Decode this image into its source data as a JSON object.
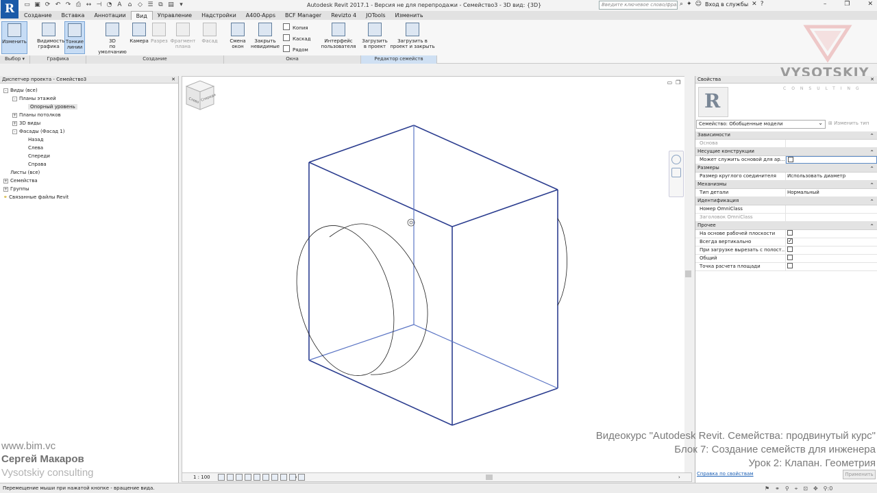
{
  "window": {
    "app_logo": "R",
    "title": "Autodesk Revit 2017.1 - Версия не для перепродажи -    Семейство3 - 3D вид: {3D}",
    "search_placeholder": "Введите ключевое слово/фразу",
    "sign_in": "Вход в службы"
  },
  "tabs": [
    "Создание",
    "Вставка",
    "Аннотации",
    "Вид",
    "Управление",
    "Надстройки",
    "A400-Apps",
    "BCF Manager",
    "Revizto 4",
    "JOTools",
    "Изменить"
  ],
  "active_tab": "Вид",
  "ribbon": {
    "buttons": [
      {
        "label1": "Изменить",
        "label2": "",
        "state": "selected"
      },
      {
        "label1": "Видимость/",
        "label2": "графика",
        "state": "normal"
      },
      {
        "label1": "Тонкие",
        "label2": "линии",
        "state": "selected"
      },
      {
        "label1": "3D",
        "label2": "по умолчанию",
        "state": "normal"
      },
      {
        "label1": "Камера",
        "label2": "",
        "state": "normal"
      },
      {
        "label1": "Разрез",
        "label2": "",
        "state": "disabled"
      },
      {
        "label1": "Фрагмент",
        "label2": "плана",
        "state": "disabled"
      },
      {
        "label1": "Фасад",
        "label2": "",
        "state": "disabled"
      },
      {
        "label1": "Смена",
        "label2": "окон",
        "state": "normal"
      },
      {
        "label1": "Закрыть",
        "label2": "невидимые",
        "state": "normal"
      },
      {
        "label1": "Интерфейс",
        "label2": "пользователя",
        "state": "normal"
      },
      {
        "label1": "Загрузить",
        "label2": "в проект",
        "state": "normal"
      },
      {
        "label1": "Загрузить в",
        "label2": "проект и закрыть",
        "state": "normal"
      }
    ],
    "window_small_buttons": [
      "Копия",
      "Каскад",
      "Рядом"
    ],
    "panels": [
      "Выбор",
      "Графика",
      "Создание",
      "Окна",
      "Редактор семейств"
    ]
  },
  "brand": {
    "name": "VYSOTSKIY",
    "sub": "CONSULTING"
  },
  "project_browser": {
    "title": "Диспетчер проекта - Семейство3",
    "tree": [
      {
        "label": "Виды (все)",
        "level": 0,
        "toggle": "-"
      },
      {
        "label": "Планы этажей",
        "level": 1,
        "toggle": "-"
      },
      {
        "label": "Опорный уровень",
        "level": 2,
        "toggle": "",
        "selected": true
      },
      {
        "label": "Планы потолков",
        "level": 1,
        "toggle": "+"
      },
      {
        "label": "3D виды",
        "level": 1,
        "toggle": "+"
      },
      {
        "label": "Фасады (Фасад 1)",
        "level": 1,
        "toggle": "-"
      },
      {
        "label": "Назад",
        "level": 2,
        "toggle": ""
      },
      {
        "label": "Слева",
        "level": 2,
        "toggle": ""
      },
      {
        "label": "Спереди",
        "level": 2,
        "toggle": ""
      },
      {
        "label": "Справа",
        "level": 2,
        "toggle": ""
      },
      {
        "label": "Листы (все)",
        "level": 0,
        "toggle": ""
      },
      {
        "label": "Семейства",
        "level": 0,
        "toggle": "+"
      },
      {
        "label": "Группы",
        "level": 0,
        "toggle": "+"
      },
      {
        "label": "Связанные файлы Revit",
        "level": 0,
        "toggle": "",
        "icon": "link-icon"
      }
    ]
  },
  "viewcube": {
    "face1": "Слева",
    "face2": "Спереди"
  },
  "view_control": {
    "scale": "1 : 100"
  },
  "properties": {
    "title": "Свойства",
    "type_selector": "Семейство: Обобщенные модели",
    "edit_type": "Изменить тип",
    "rows": [
      {
        "type": "section",
        "label": "Зависимости"
      },
      {
        "type": "row",
        "label": "Основа",
        "value": "",
        "dim": true
      },
      {
        "type": "section",
        "label": "Несущие конструкции"
      },
      {
        "type": "row",
        "label": "Может служить основой для ар...",
        "value": "",
        "check": "off",
        "highlight": true
      },
      {
        "type": "section",
        "label": "Размеры"
      },
      {
        "type": "row",
        "label": "Размер круглого соединителя",
        "value": "Использовать диаметр"
      },
      {
        "type": "section",
        "label": "Механизмы"
      },
      {
        "type": "row",
        "label": "Тип детали",
        "value": "Нормальный"
      },
      {
        "type": "section",
        "label": "Идентификация"
      },
      {
        "type": "row",
        "label": "Номер OmniClass",
        "value": ""
      },
      {
        "type": "row",
        "label": "Заголовок OmniClass",
        "value": "",
        "dim": true
      },
      {
        "type": "section",
        "label": "Прочее"
      },
      {
        "type": "row",
        "label": "На основе рабочей плоскости",
        "value": "",
        "check": "off"
      },
      {
        "type": "row",
        "label": "Всегда вертикально",
        "value": "",
        "check": "on"
      },
      {
        "type": "row",
        "label": "При загрузке вырезать с полост...",
        "value": "",
        "check": "off"
      },
      {
        "type": "row",
        "label": "Общий",
        "value": "",
        "check": "off"
      },
      {
        "type": "row",
        "label": "Точка расчета площади",
        "value": "",
        "check": "off"
      }
    ],
    "help_link": "Справка по свойствам",
    "apply": "Применить"
  },
  "status": {
    "text": "Перемещение мыши при нажатой кнопке - вращение вида.",
    "filter_count": ":0"
  },
  "overlay": {
    "left": [
      "www.bim.vc",
      "Сергей Макаров",
      "Vysotskiy consulting"
    ],
    "right": [
      "Видеокурс \"Autodesk Revit. Семейства: продвинутый курс\"",
      "Блок 7: Создание семейств для инженера",
      "Урок 2: Клапан. Геометрия"
    ]
  },
  "colors": {
    "accent": "#1a5aa8",
    "model_lines": "#2b3d8f",
    "ribbon_selected": "#c6dcf5"
  }
}
